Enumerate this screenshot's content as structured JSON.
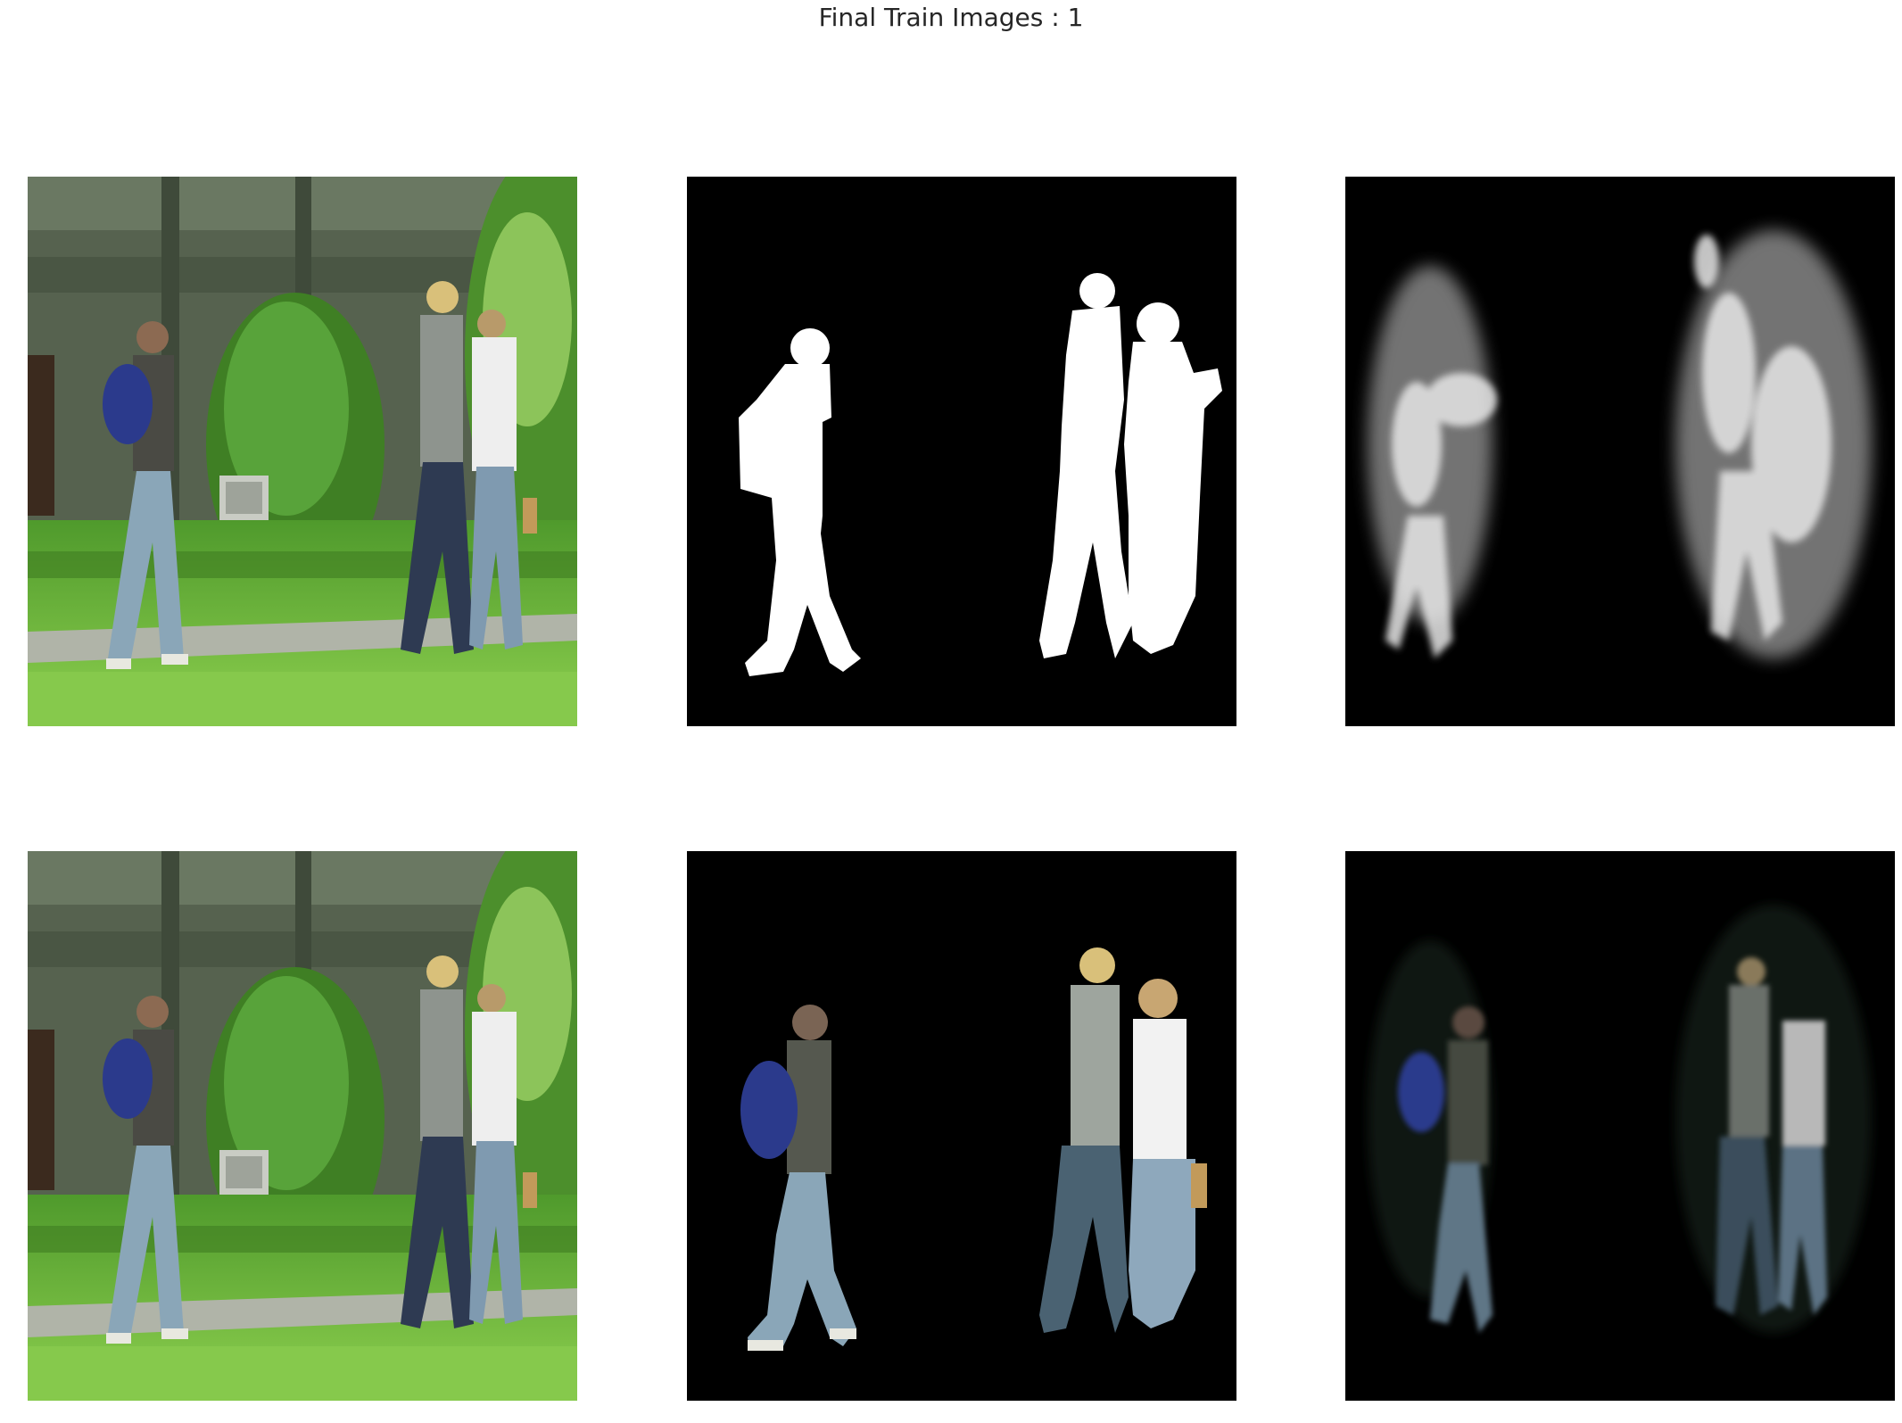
{
  "figure": {
    "title": "Final Train Images : 1"
  },
  "panels": [
    {
      "row": 1,
      "col": 1,
      "content": "input-photo"
    },
    {
      "row": 1,
      "col": 2,
      "content": "ground-truth-mask"
    },
    {
      "row": 1,
      "col": 3,
      "content": "predicted-mask"
    },
    {
      "row": 2,
      "col": 1,
      "content": "input-photo"
    },
    {
      "row": 2,
      "col": 2,
      "content": "masked-input"
    },
    {
      "row": 2,
      "col": 3,
      "content": "masked-prediction"
    }
  ],
  "colors": {
    "grass": "#6fbf3c",
    "building": "#4f5e4a",
    "tree": "#4a8a2e",
    "jeans": "#8aa6b8",
    "backpack": "#2b3a8c",
    "mask_fg": "#ffffff",
    "mask_bg": "#000000"
  }
}
